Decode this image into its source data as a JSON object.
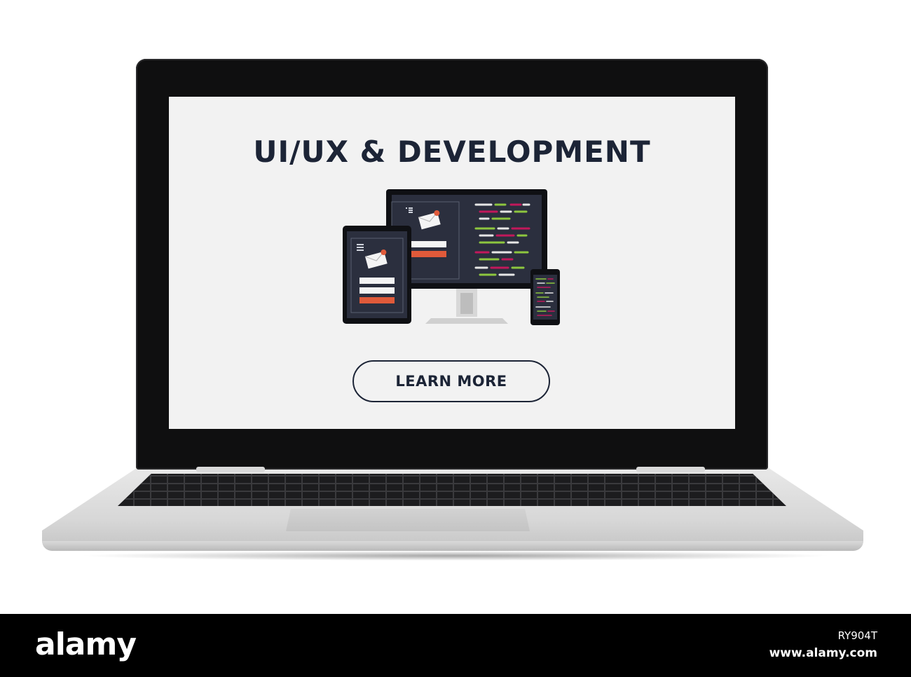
{
  "screen": {
    "title": "UI/UX & DEVELOPMENT",
    "cta_label": "LEARN MORE",
    "illustration_icons": [
      "desktop-monitor-icon",
      "tablet-icon",
      "smartphone-icon",
      "envelope-icon",
      "menu-icon"
    ]
  },
  "watermark": {
    "logo": "alamy",
    "image_id": "RY904T",
    "url": "www.alamy.com"
  },
  "colors": {
    "title": "#1c2436",
    "screen_bg": "#f2f2f2",
    "device_panel": "#2b2f3e",
    "accent_red": "#e05a3a",
    "code_green": "#8dc63f",
    "code_pink": "#c2185b",
    "strip_bg": "#000000"
  }
}
